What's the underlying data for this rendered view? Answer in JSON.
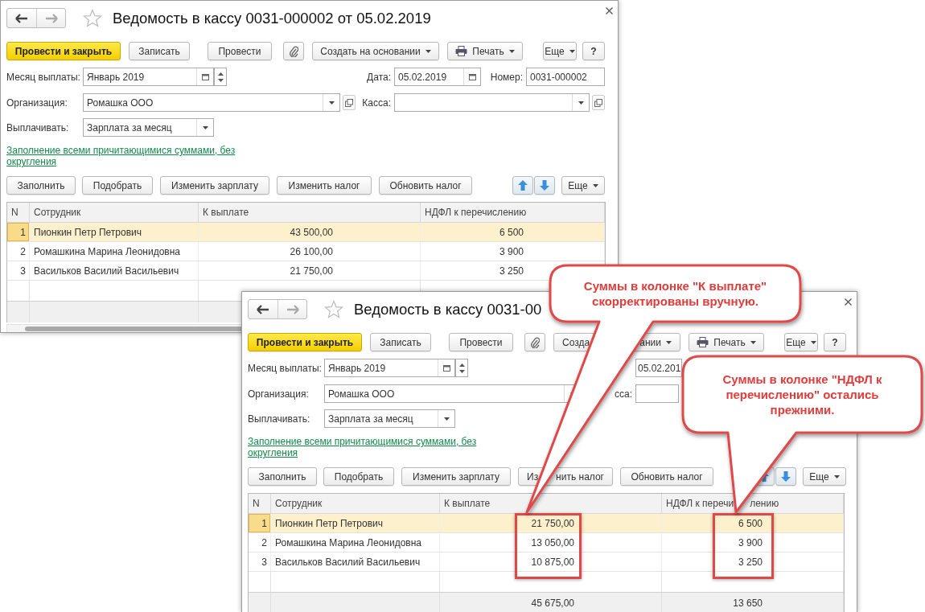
{
  "windows": [
    {
      "title": "Ведомость в кассу 0031-000002 от 05.02.2019",
      "toolbar": [
        {
          "kind": "primary",
          "label": "Провести и закрыть"
        },
        {
          "kind": "button",
          "label": "Записать"
        },
        {
          "kind": "button",
          "label": "Провести"
        },
        {
          "kind": "attach"
        },
        {
          "kind": "menu",
          "label": "Создать на основании"
        },
        {
          "kind": "print",
          "label": "Печать"
        },
        {
          "kind": "menu",
          "label": "Еще"
        },
        {
          "kind": "help",
          "label": "?"
        }
      ],
      "month": {
        "label": "Месяц выплаты:",
        "value": "Январь 2019"
      },
      "date": {
        "label": "Дата:",
        "value": "05.02.2019"
      },
      "number": {
        "label": "Номер:",
        "value": "0031-000002"
      },
      "organization": {
        "label": "Организация:",
        "value": "Ромашка ООО"
      },
      "cash_desk": {
        "label": "Касса:"
      },
      "pay_type": {
        "label": "Выплачивать:",
        "value": "Зарплата за месяц"
      },
      "fill_link": "Заполнение всеми причитающимися суммами, без округления",
      "table_toolbar": [
        {
          "kind": "button",
          "label": "Заполнить"
        },
        {
          "kind": "button",
          "label": "Подобрать"
        },
        {
          "kind": "button",
          "label": "Изменить зарплату"
        },
        {
          "kind": "button",
          "label": "Изменить налог"
        },
        {
          "kind": "button",
          "label": "Обновить налог"
        },
        {
          "kind": "arrows"
        },
        {
          "kind": "menu",
          "label": "Еще"
        }
      ],
      "table": {
        "columns": [
          {
            "label": "N"
          },
          {
            "label": "Сотрудник"
          },
          {
            "label": "К выплате"
          },
          {
            "label": "НДФЛ к перечислению"
          }
        ],
        "rows": [
          {
            "n": "1",
            "employee": "Пионкин Петр Петрович",
            "to_pay": "43 500,00",
            "tax": "6 500",
            "selected": true
          },
          {
            "n": "2",
            "employee": "Ромашкина Марина Леонидовна",
            "to_pay": "26 100,00",
            "tax": "3 900",
            "selected": false
          },
          {
            "n": "3",
            "employee": "Васильков Василий Васильевич",
            "to_pay": "21 750,00",
            "tax": "3 250",
            "selected": false
          }
        ]
      }
    },
    {
      "title": "Ведомость в кассу 0031-00",
      "toolbar": [
        {
          "kind": "primary",
          "label": "Провести и закрыть"
        },
        {
          "kind": "button",
          "label": "Записать"
        },
        {
          "kind": "button",
          "label": "Провести"
        },
        {
          "kind": "attach"
        },
        {
          "kind": "menu",
          "label": "Созда",
          "label_end": "ании"
        },
        {
          "kind": "print",
          "label": "Печать"
        },
        {
          "kind": "menu",
          "label": "Еще"
        },
        {
          "kind": "help",
          "label": "?"
        }
      ],
      "month": {
        "label": "Месяц выплаты:",
        "value": "Январь 2019"
      },
      "date": {
        "value": "05.02.201"
      },
      "organization": {
        "label": "Организация:",
        "value": "Ромашка ООО"
      },
      "cash_desk": {
        "label": "сса:"
      },
      "pay_type": {
        "label": "Выплачивать:",
        "value": "Зарплата за месяц"
      },
      "fill_link": "Заполнение всеми причитающимися суммами, без округления",
      "table_toolbar": [
        {
          "kind": "button",
          "label": "Заполнить"
        },
        {
          "kind": "button",
          "label": "Подобрать"
        },
        {
          "kind": "button",
          "label": "Изменить зарплату"
        },
        {
          "kind": "button",
          "label": "Из",
          "label_end": "нить налог"
        },
        {
          "kind": "button",
          "label": "Обновить налог"
        },
        {
          "kind": "arrows"
        },
        {
          "kind": "menu",
          "label": "Еще"
        }
      ],
      "table": {
        "columns": [
          {
            "label": "N"
          },
          {
            "label": "Сотрудник"
          },
          {
            "label": "К выплате",
            "highlighted": true
          },
          {
            "label": "НДФЛ к перечи",
            "label_end": "лению",
            "highlighted": true
          }
        ],
        "rows": [
          {
            "n": "1",
            "employee": "Пионкин Петр Петрович",
            "to_pay": "21 750,00",
            "tax": "6 500",
            "selected": true
          },
          {
            "n": "2",
            "employee": "Ромашкина Марина Леонидовна",
            "to_pay": "13 050,00",
            "tax": "3 900",
            "selected": false
          },
          {
            "n": "3",
            "employee": "Васильков Василий Васильевич",
            "to_pay": "10 875,00",
            "tax": "3 250",
            "selected": false
          }
        ],
        "totals": {
          "to_pay": "45 675,00",
          "tax": "13 650"
        }
      }
    }
  ],
  "callouts": [
    {
      "text": "Суммы в колонке \"К выплате\" скорректированы вручную."
    },
    {
      "text": "Суммы в колонке \"НДФЛ к перечислению\" остались прежними."
    }
  ]
}
